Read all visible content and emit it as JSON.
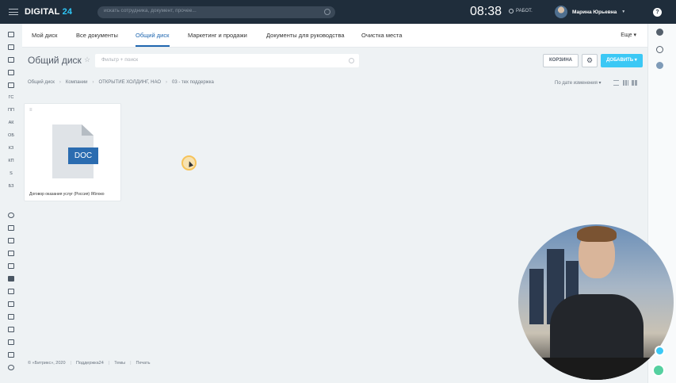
{
  "topbar": {
    "logo_main": "DIGITAL",
    "logo_num": "24",
    "search_placeholder": "искать сотрудника, документ, прочее...",
    "time": "08:38",
    "status": "РАБОТ.",
    "user_name": "Марина Юрьевна",
    "help": "?"
  },
  "leftbar": {
    "labels": [
      "ГС",
      "ПП",
      "АК",
      "ОБ",
      "КЗ",
      "КП",
      "S",
      "БЗ"
    ]
  },
  "tabs": {
    "items": [
      "Мой диск",
      "Все документы",
      "Общий диск",
      "Маркетинг и продажи",
      "Документы для руководства",
      "Очистка места"
    ],
    "active": "Общий диск",
    "more": "Еще"
  },
  "page": {
    "title": "Общий диск",
    "filter_placeholder": "Фильтр + поиск",
    "trash_button": "КОРЗИНА",
    "add_button": "ДОБАВИТЬ"
  },
  "breadcrumbs": [
    "Общий диск",
    "Компании",
    "ОТКРЫТИЕ ХОЛДИНГ, НАО",
    "03 - тех поддержка"
  ],
  "sort_label": "По дате изменения",
  "files": [
    {
      "type_label": "DOC",
      "name": "Договор оказания услуг (Россия) Яблоко"
    }
  ],
  "footer": {
    "copyright": "© «Битрикс», 2020",
    "links": [
      "Поддержка24",
      "Темы",
      "Печать"
    ]
  }
}
